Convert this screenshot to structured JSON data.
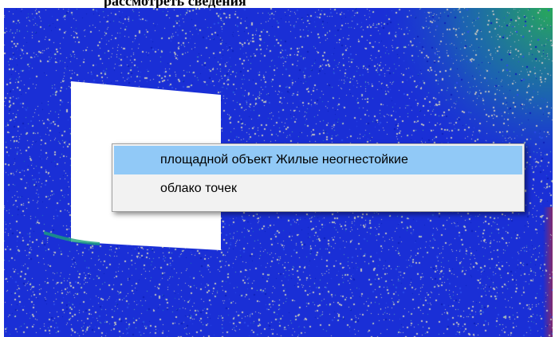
{
  "header": {
    "caption_fragment": "рассмотреть сведения"
  },
  "context_menu": {
    "items": [
      {
        "label": "площадной объект Жилые неогнестойкие",
        "highlighted": true
      },
      {
        "label": "облако точек",
        "highlighted": false
      }
    ]
  },
  "colors": {
    "cloud_base": "#1a2fd6",
    "cloud_noise": "#bfbfbf",
    "cloud_green": "#1aa07a",
    "menu_highlight": "#91c9f7",
    "menu_background": "#f2f2f2"
  }
}
